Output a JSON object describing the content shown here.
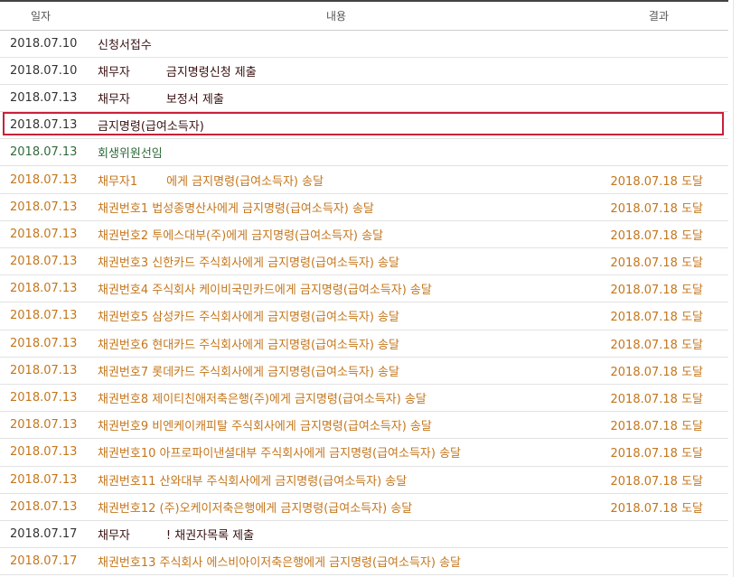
{
  "header": {
    "date": "일자",
    "content": "내용",
    "result": "결과"
  },
  "rows": [
    {
      "date": "2018.07.10",
      "actor": "",
      "text": "신청서접수",
      "result": "",
      "style": "dark",
      "pad": ""
    },
    {
      "date": "2018.07.10",
      "actor": "채무자",
      "text": "금지명령신청 제출",
      "result": "",
      "style": "dark",
      "pad": "p1"
    },
    {
      "date": "2018.07.13",
      "actor": "채무자",
      "text": "보정서 제출",
      "result": "",
      "style": "dark",
      "pad": "p2"
    },
    {
      "date": "2018.07.13",
      "actor": "",
      "text": "금지명령(급여소득자)",
      "result": "",
      "style": "dark",
      "pad": ""
    },
    {
      "date": "2018.07.13",
      "actor": "",
      "text": "회생위원선임",
      "result": "",
      "style": "green",
      "pad": ""
    },
    {
      "date": "2018.07.13",
      "actor": "채무자1",
      "text": "에게 금지명령(급여소득자) 송달",
      "result": "2018.07.18 도달",
      "style": "orange",
      "pad": "p3"
    },
    {
      "date": "2018.07.13",
      "actor": "",
      "text": "채권번호1 법성종명산사에게 금지명령(급여소득자) 송달",
      "result": "2018.07.18 도달",
      "style": "orange",
      "pad": ""
    },
    {
      "date": "2018.07.13",
      "actor": "",
      "text": "채권번호2 투에스대부(주)에게 금지명령(급여소득자) 송달",
      "result": "2018.07.18 도달",
      "style": "orange",
      "pad": ""
    },
    {
      "date": "2018.07.13",
      "actor": "",
      "text": "채권번호3 신한카드 주식회사에게 금지명령(급여소득자) 송달",
      "result": "2018.07.18 도달",
      "style": "orange",
      "pad": ""
    },
    {
      "date": "2018.07.13",
      "actor": "",
      "text": "채권번호4 주식회사 케이비국민카드에게 금지명령(급여소득자) 송달",
      "result": "2018.07.18 도달",
      "style": "orange",
      "pad": ""
    },
    {
      "date": "2018.07.13",
      "actor": "",
      "text": "채권번호5 삼성카드 주식회사에게 금지명령(급여소득자) 송달",
      "result": "2018.07.18 도달",
      "style": "orange",
      "pad": ""
    },
    {
      "date": "2018.07.13",
      "actor": "",
      "text": "채권번호6 현대카드 주식회사에게 금지명령(급여소득자) 송달",
      "result": "2018.07.18 도달",
      "style": "orange",
      "pad": ""
    },
    {
      "date": "2018.07.13",
      "actor": "",
      "text": "채권번호7 롯데카드 주식회사에게 금지명령(급여소득자) 송달",
      "result": "2018.07.18 도달",
      "style": "orange",
      "pad": ""
    },
    {
      "date": "2018.07.13",
      "actor": "",
      "text": "채권번호8 제이티친애저축은행(주)에게 금지명령(급여소득자) 송달",
      "result": "2018.07.18 도달",
      "style": "orange",
      "pad": ""
    },
    {
      "date": "2018.07.13",
      "actor": "",
      "text": "채권번호9 비엔케이캐피탈 주식회사에게 금지명령(급여소득자) 송달",
      "result": "2018.07.18 도달",
      "style": "orange",
      "pad": ""
    },
    {
      "date": "2018.07.13",
      "actor": "",
      "text": "채권번호10 아프로파이낸셜대부 주식회사에게 금지명령(급여소득자) 송달",
      "result": "2018.07.18 도달",
      "style": "orange",
      "pad": ""
    },
    {
      "date": "2018.07.13",
      "actor": "",
      "text": "채권번호11 산와대부 주식회사에게 금지명령(급여소득자) 송달",
      "result": "2018.07.18 도달",
      "style": "orange",
      "pad": ""
    },
    {
      "date": "2018.07.13",
      "actor": "",
      "text": "채권번호12 (주)오케이저축은행에게 금지명령(급여소득자) 송달",
      "result": "2018.07.18 도달",
      "style": "orange",
      "pad": ""
    },
    {
      "date": "2018.07.17",
      "actor": "채무자",
      "text": "! 채권자목록 제출",
      "result": "",
      "style": "dark",
      "pad": "p4"
    },
    {
      "date": "2018.07.17",
      "actor": "",
      "text": "채권번호13 주식회사 에스비아이저축은행에게 금지명령(급여소득자) 송달",
      "result": "",
      "style": "orange",
      "pad": ""
    }
  ],
  "highlighted_row": 3,
  "colors": {
    "highlight_border": "#c8203a",
    "dark_text": "#3a1212",
    "green_text": "#2f6b3a",
    "orange_text": "#c4761c"
  }
}
